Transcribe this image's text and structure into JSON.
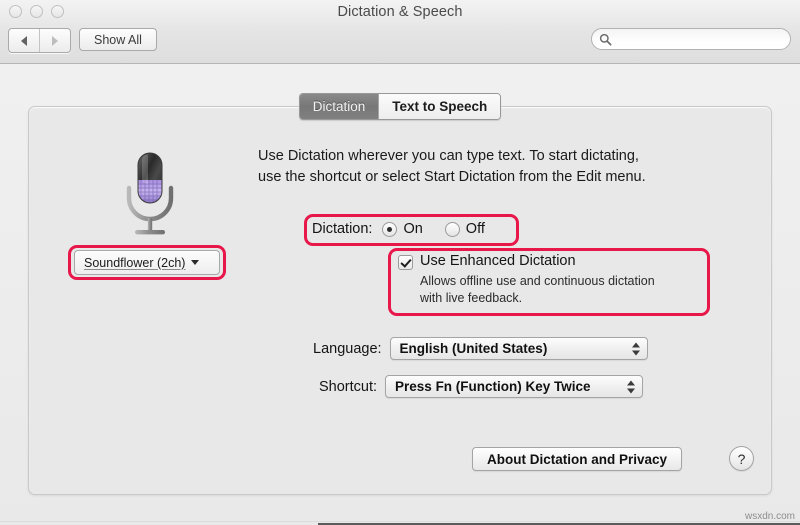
{
  "window": {
    "title": "Dictation & Speech",
    "traffic_lights": [
      "close",
      "minimize",
      "zoom"
    ]
  },
  "toolbar": {
    "back_label": "back-arrow",
    "forward_label": "forward-arrow",
    "show_all_label": "Show All",
    "search_placeholder": "",
    "search_value": "",
    "search_icon": "search-icon"
  },
  "tabs": [
    {
      "label": "Dictation",
      "selected": true
    },
    {
      "label": "Text to Speech",
      "selected": false
    }
  ],
  "main": {
    "intro_line1": "Use Dictation wherever you can type text. To start dictating,",
    "intro_line2": "use the shortcut or select Start Dictation from the Edit menu.",
    "mic_icon": "microphone-icon",
    "source_popup": {
      "value": "Soundflower (2ch)",
      "arrow_icon": "chevron-down-icon"
    },
    "dictation": {
      "label": "Dictation:",
      "on_label": "On",
      "off_label": "Off",
      "selected": "On"
    },
    "enhanced": {
      "title": "Use Enhanced Dictation",
      "checked": true,
      "desc_line1": "Allows offline use and continuous dictation",
      "desc_line2": "with live feedback."
    },
    "language": {
      "label": "Language:",
      "value": "English (United States)"
    },
    "shortcut": {
      "label": "Shortcut:",
      "value": "Press Fn (Function) Key Twice"
    },
    "about_button": "About Dictation and Privacy",
    "help_button": "?"
  },
  "annotations": {
    "color": "#e8174a",
    "boxes": [
      "source-popup",
      "dictation-radios",
      "enhanced-dictation"
    ]
  },
  "watermark": "wsxdn.com"
}
